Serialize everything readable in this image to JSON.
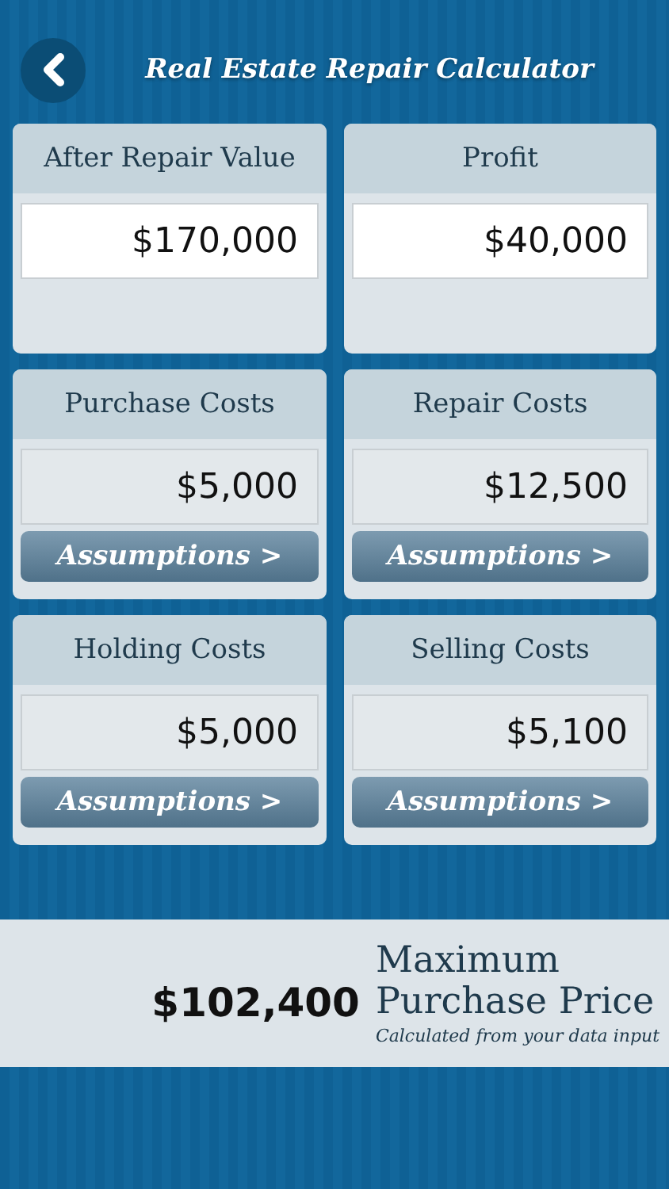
{
  "header": {
    "title": "Real Estate Repair Calculator"
  },
  "cards": [
    {
      "label": "After Repair Value",
      "value": "$170,000",
      "editable": true
    },
    {
      "label": "Profit",
      "value": "$40,000",
      "editable": true
    },
    {
      "label": "Purchase Costs",
      "value": "$5,000",
      "editable": false,
      "button": "Assumptions >"
    },
    {
      "label": "Repair Costs",
      "value": "$12,500",
      "editable": false,
      "button": "Assumptions >"
    },
    {
      "label": "Holding Costs",
      "value": "$5,000",
      "editable": false,
      "button": "Assumptions >"
    },
    {
      "label": "Selling Costs",
      "value": "$5,100",
      "editable": false,
      "button": "Assumptions >"
    }
  ],
  "result": {
    "amount": "$102,400",
    "title_line_1": "Maximum",
    "title_line_2": "Purchase Price",
    "note": "Calculated from your data input"
  }
}
